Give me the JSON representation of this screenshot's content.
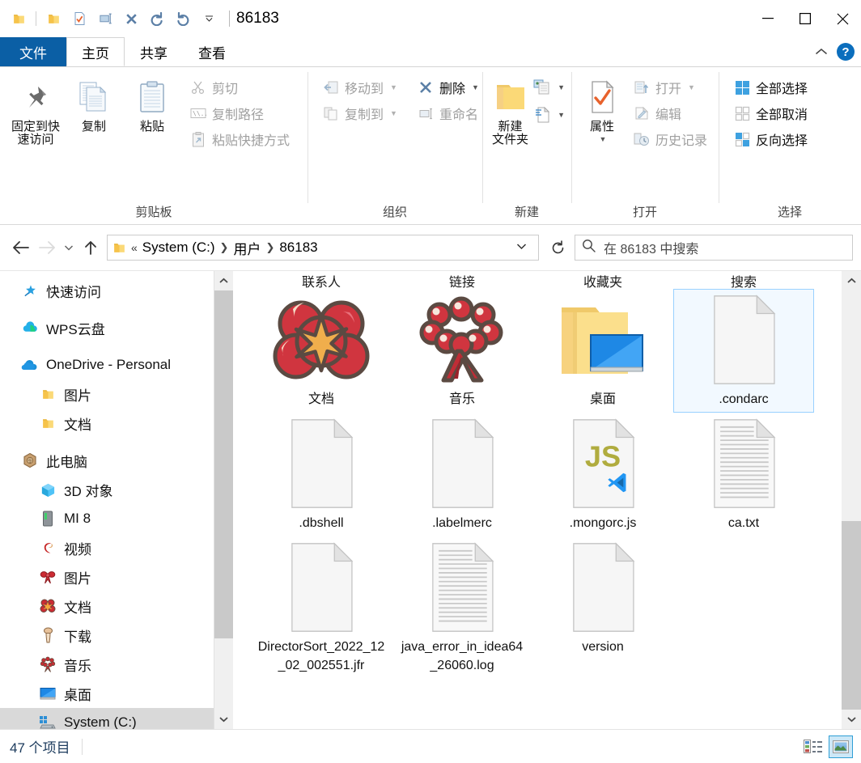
{
  "window": {
    "title": "86183",
    "quick_access_buttons": [
      "folder-icon",
      "separator",
      "folder-icon",
      "properties-checkmark-icon",
      "rename-icon",
      "delete-icon",
      "redo-icon",
      "undo-icon",
      "customize-dropdown-icon"
    ],
    "controls": {
      "minimize": "minimize-button",
      "maximize": "maximize-button",
      "close": "close-button"
    }
  },
  "tabs": [
    {
      "label": "文件",
      "name": "tab-file",
      "state": "file-menu"
    },
    {
      "label": "主页",
      "name": "tab-home",
      "state": "active"
    },
    {
      "label": "共享",
      "name": "tab-share",
      "state": "normal"
    },
    {
      "label": "查看",
      "name": "tab-view",
      "state": "normal"
    }
  ],
  "tab_right": {
    "collapse_ribbon": "chevron-up-icon",
    "help": "?"
  },
  "ribbon": {
    "groups": [
      {
        "title": "剪贴板",
        "name": "ribbon-group-clipboard",
        "big": [
          {
            "label": "固定到快\n速访问",
            "label_line1": "固定到快",
            "label_line2": "速访问",
            "icon": "pin-icon",
            "disabled": false
          },
          {
            "label": "复制",
            "icon": "copy-icon",
            "disabled": false
          },
          {
            "label": "粘贴",
            "icon": "paste-icon",
            "disabled": false
          }
        ],
        "small": [
          {
            "label": "剪切",
            "icon": "scissors-icon",
            "disabled": true
          },
          {
            "label": "复制路径",
            "icon": "copy-path-icon",
            "disabled": true
          },
          {
            "label": "粘贴快捷方式",
            "icon": "paste-shortcut-icon",
            "disabled": true
          }
        ]
      },
      {
        "title": "组织",
        "name": "ribbon-group-organize",
        "small": [
          {
            "label": "移动到",
            "icon": "move-to-icon",
            "disabled": true,
            "caret": true
          },
          {
            "label": "复制到",
            "icon": "copy-to-icon",
            "disabled": true,
            "caret": true
          }
        ],
        "small2": [
          {
            "label": "删除",
            "icon": "delete-x-icon",
            "disabled": false,
            "caret": true
          },
          {
            "label": "重命名",
            "icon": "rename-icon",
            "disabled": true,
            "caret": false
          }
        ]
      },
      {
        "title": "新建",
        "name": "ribbon-group-new",
        "big": [
          {
            "label_line1": "新建",
            "label_line2": "文件夹",
            "icon": "new-folder-icon",
            "disabled": false
          }
        ],
        "stack": [
          {
            "icon": "new-item-icon",
            "caret": true,
            "name": "new-item-button"
          },
          {
            "icon": "easy-access-icon",
            "caret": true,
            "name": "easy-access-button"
          }
        ]
      },
      {
        "title": "打开",
        "name": "ribbon-group-open",
        "big": [
          {
            "label": "属性",
            "icon": "properties-icon",
            "disabled": false,
            "caret": true
          }
        ],
        "small": [
          {
            "label": "打开",
            "icon": "open-icon",
            "disabled": true,
            "caret": true
          },
          {
            "label": "编辑",
            "icon": "edit-icon",
            "disabled": true
          },
          {
            "label": "历史记录",
            "icon": "history-icon",
            "disabled": true
          }
        ]
      },
      {
        "title": "选择",
        "name": "ribbon-group-select",
        "small": [
          {
            "label": "全部选择",
            "icon": "select-all-icon",
            "disabled": false
          },
          {
            "label": "全部取消",
            "icon": "select-none-icon",
            "disabled": false
          },
          {
            "label": "反向选择",
            "icon": "invert-selection-icon",
            "disabled": false
          }
        ]
      }
    ]
  },
  "address": {
    "back": "back-arrow-icon",
    "forward": "forward-arrow-icon",
    "recent": "recent-dropdown-icon",
    "up": "up-arrow-icon",
    "folder_icon": "folder-icon",
    "overflow": "«",
    "crumbs": [
      "System (C:)",
      "用户",
      "86183"
    ],
    "dropdown": "chevron-down-icon",
    "refresh": "refresh-icon"
  },
  "search": {
    "icon": "search-icon",
    "placeholder": "在 86183 中搜索",
    "value": ""
  },
  "sidebar": {
    "items": [
      {
        "label": "快速访问",
        "icon": "pin-star-icon",
        "level": 0,
        "selected": false,
        "name": "sidebar-item-quick-access"
      },
      {
        "label": "WPS云盘",
        "icon": "wps-cloud-icon",
        "level": 0,
        "selected": false,
        "name": "sidebar-item-wps-cloud"
      },
      {
        "label": "OneDrive - Personal",
        "icon": "onedrive-icon",
        "level": 0,
        "selected": false,
        "name": "sidebar-item-onedrive"
      },
      {
        "label": "图片",
        "icon": "folder-icon",
        "level": 1,
        "selected": false,
        "name": "sidebar-item-onedrive-pictures"
      },
      {
        "label": "文档",
        "icon": "folder-icon",
        "level": 1,
        "selected": false,
        "name": "sidebar-item-onedrive-documents"
      },
      {
        "label": "此电脑",
        "icon": "this-pc-icon",
        "level": 0,
        "selected": false,
        "name": "sidebar-item-this-pc"
      },
      {
        "label": "3D 对象",
        "icon": "3d-objects-icon",
        "level": 1,
        "selected": false,
        "name": "sidebar-item-3d-objects"
      },
      {
        "label": "MI 8",
        "icon": "phone-icon",
        "level": 1,
        "selected": false,
        "name": "sidebar-item-mi8"
      },
      {
        "label": "视频",
        "icon": "videos-icon",
        "level": 1,
        "selected": false,
        "name": "sidebar-item-videos"
      },
      {
        "label": "图片",
        "icon": "pictures-bow-icon",
        "level": 1,
        "selected": false,
        "name": "sidebar-item-pictures"
      },
      {
        "label": "文档",
        "icon": "documents-flower-icon",
        "level": 1,
        "selected": false,
        "name": "sidebar-item-documents"
      },
      {
        "label": "下载",
        "icon": "downloads-icon",
        "level": 1,
        "selected": false,
        "name": "sidebar-item-downloads"
      },
      {
        "label": "音乐",
        "icon": "music-beads-icon",
        "level": 1,
        "selected": false,
        "name": "sidebar-item-music"
      },
      {
        "label": "桌面",
        "icon": "desktop-icon",
        "level": 1,
        "selected": false,
        "name": "sidebar-item-desktop"
      },
      {
        "label": "System (C:)",
        "icon": "windows-drive-icon",
        "level": 1,
        "selected": true,
        "name": "sidebar-item-system-c"
      }
    ]
  },
  "content": {
    "partial_top_labels": [
      "联系人",
      "链接",
      "收藏夹",
      "搜索"
    ],
    "rows": [
      [
        {
          "name": "文档",
          "icon": "flower-folder-icon",
          "selected": false
        },
        {
          "name": "音乐",
          "icon": "beads-folder-icon",
          "selected": false
        },
        {
          "name": "桌面",
          "icon": "desktop-folder-icon",
          "selected": false
        },
        {
          "name": ".condarc",
          "icon": "blank-file-icon",
          "selected": true
        }
      ],
      [
        {
          "name": ".dbshell",
          "icon": "blank-file-icon",
          "selected": false
        },
        {
          "name": ".labelmerc",
          "icon": "blank-file-icon",
          "selected": false
        },
        {
          "name": ".mongorc.js",
          "icon": "js-vscode-file-icon",
          "selected": false
        },
        {
          "name": "ca.txt",
          "icon": "text-file-icon",
          "selected": false
        }
      ],
      [
        {
          "name": "DirectorSort_2022_12_02_002551.jfr",
          "icon": "blank-file-icon",
          "selected": false
        },
        {
          "name": "java_error_in_idea64_26060.log",
          "icon": "text-file-icon",
          "selected": false
        },
        {
          "name": "version",
          "icon": "blank-file-icon",
          "selected": false
        }
      ]
    ]
  },
  "status": {
    "item_count": "47 个项目",
    "views": [
      {
        "name": "details-view-button",
        "icon": "details-view-icon",
        "active": false
      },
      {
        "name": "large-icons-view-button",
        "icon": "large-icons-view-icon",
        "active": true
      }
    ]
  },
  "colors": {
    "file_tab_blue": "#0b5fa5",
    "selection_blue": "#99d1ff",
    "selection_fill": "#f2f9ff",
    "sidebar_selected": "#d9d9d9",
    "folder_yellow": "#fbd977",
    "js_yellow": "#b0ac3f",
    "vscode_blue": "#2196f3",
    "status_text": "#1b3a5c"
  }
}
